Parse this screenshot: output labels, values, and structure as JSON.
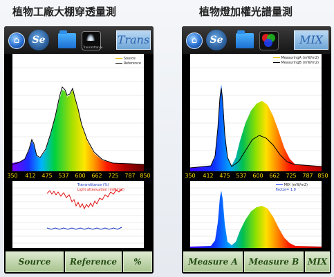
{
  "left": {
    "caption": "植物工廠大棚穿透量測",
    "mode_label": "Trans",
    "lamp_icon_text": "Transmittance",
    "top_legend": [
      "Source",
      "Reference"
    ],
    "axis_ticks": [
      "350",
      "412",
      "475",
      "537",
      "600",
      "662",
      "725",
      "787",
      "850"
    ],
    "bottom_legend": [
      "Transmittance (%)",
      "Light attenuation (mW/m2)"
    ],
    "buttons": [
      "Source",
      "Reference",
      "%"
    ]
  },
  "right": {
    "caption": "植物燈加權光譜量測",
    "mode_label": "MIX",
    "top_legend": [
      "MeasuringA (mW/m2)",
      "MeasuringB (mW/m2)"
    ],
    "axis_ticks": [
      "350",
      "412",
      "475",
      "537",
      "600",
      "662",
      "725",
      "787",
      "850"
    ],
    "bottom_legend": [
      "MIX (mW/m2)",
      "Factor= 1.0"
    ],
    "buttons": [
      "Measure A",
      "Measure B",
      "MIX"
    ]
  },
  "colors": {
    "reference_line": "#000000",
    "transmittance_line": "#e01010",
    "attenuation_line": "#1030c0",
    "button_green": "#a9c48f",
    "mode_blue": "#6fa6d6",
    "axis_text": "#f5d300"
  },
  "icons": [
    "home-icon",
    "settings-icon",
    "folder-icon",
    "lamp-icon",
    "rgb-icon"
  ]
}
